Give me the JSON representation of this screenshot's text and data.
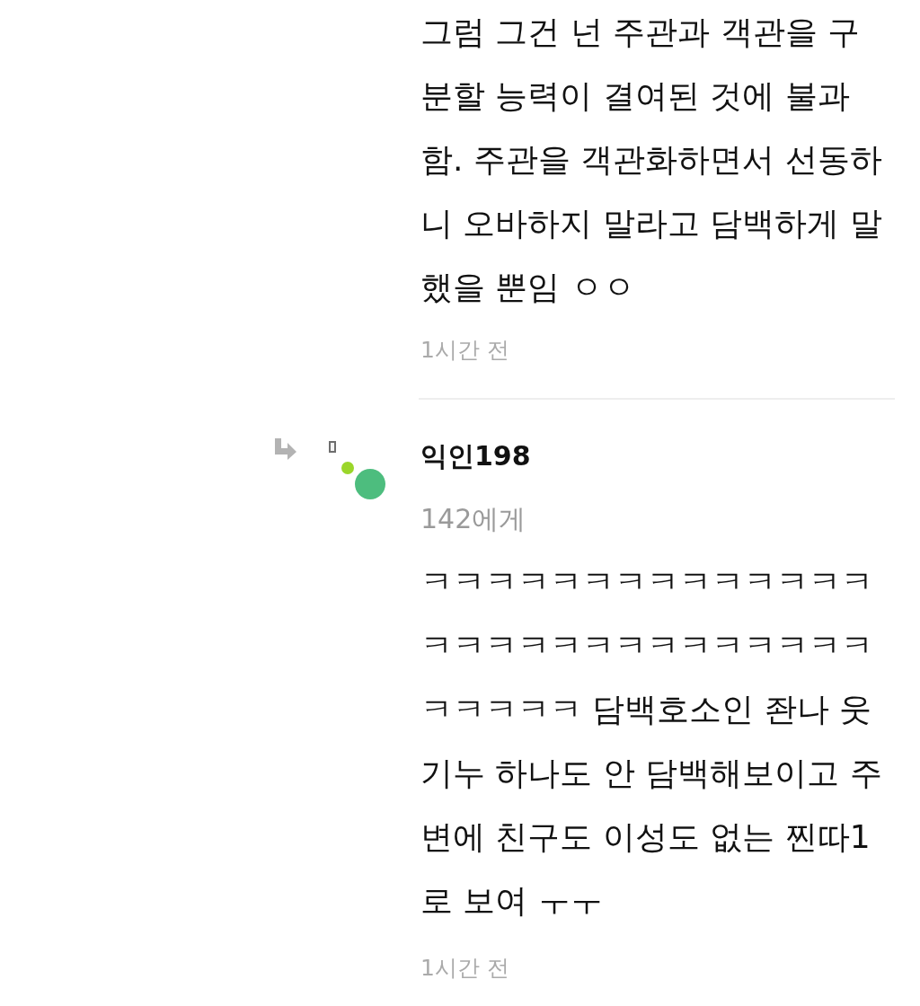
{
  "comments": [
    {
      "kind": "comment",
      "lines": [
        "그럼 그건 넌 주관과 객관을 구",
        "분할 능력이 결여된 것에 불과",
        "함. 주관을 객관화하면서 선동하",
        "니 오바하지 말라고 담백하게 말",
        "했을 뿐임 ㅇㅇ"
      ],
      "time": "1시간 전"
    },
    {
      "kind": "reply",
      "author": "익인198",
      "reply_to": "142에게",
      "lines": [
        "ㅋㅋㅋㅋㅋㅋㅋㅋㅋㅋㅋㅋㅋㅋ",
        "ㅋㅋㅋㅋㅋㅋㅋㅋㅋㅋㅋㅋㅋㅋ",
        "ㅋㅋㅋㅋㅋ 담백호소인 좐나 웃",
        "기누 하나도 안 담백해보이고 주",
        "변에 친구도 이성도 없는 찐따1",
        "로 보여 ㅜㅜ"
      ],
      "time": "1시간 전"
    }
  ]
}
